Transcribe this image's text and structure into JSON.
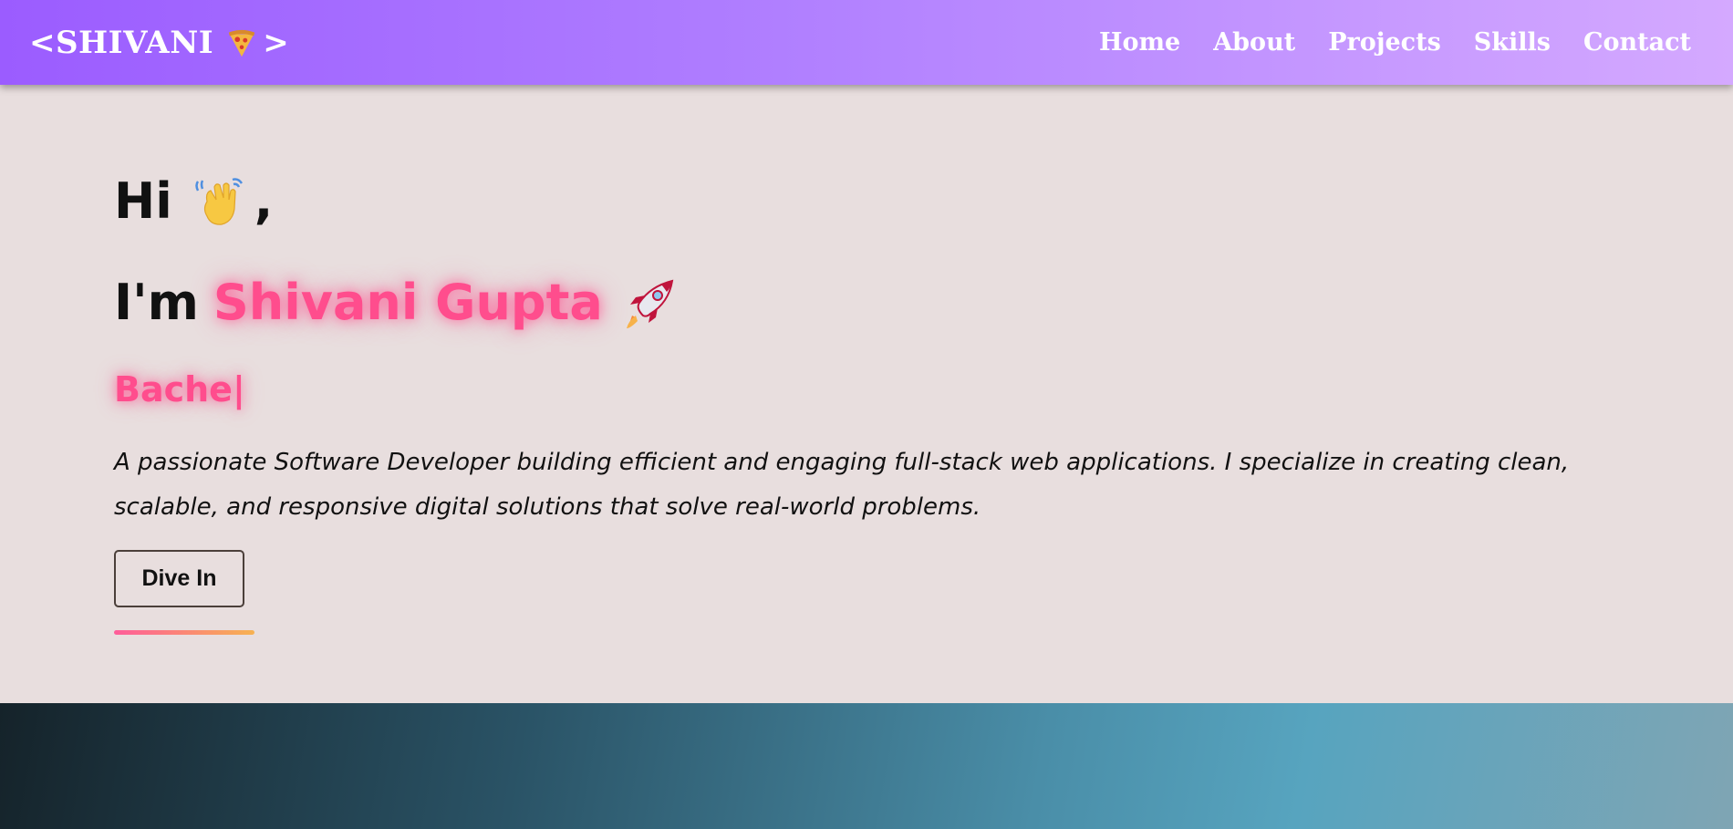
{
  "navbar": {
    "logo_prefix": "<SHIVANI",
    "logo_suffix": ">",
    "logo_icon": "pizza-icon",
    "links": [
      "Home",
      "About",
      "Projects",
      "Skills",
      "Contact"
    ]
  },
  "hero": {
    "greeting": "Hi",
    "greeting_icon": "waving-hand-icon",
    "greeting_comma": ",",
    "intro_prefix": "I'm",
    "name": "Shivani Gupta",
    "name_icon": "rocket-icon",
    "typing_text": "Bache|",
    "description": "A passionate Software Developer building efficient and engaging full-stack web applications. I specialize in creating clean, scalable, and responsive digital solutions that solve real-world problems.",
    "cta_label": "Dive In"
  },
  "colors": {
    "nav_gradient_start": "#9b5cff",
    "nav_gradient_end": "#d4a9ff",
    "accent_pink": "#ff4d8d",
    "hero_background": "#e8dede"
  }
}
